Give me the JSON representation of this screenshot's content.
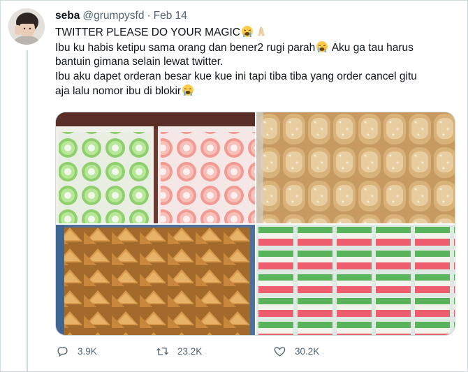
{
  "tweet": {
    "display_name": "seba",
    "handle": "@grumpysfd",
    "separator": "·",
    "date": "Feb 14",
    "line1": "TWITTER PLEASE DO YOUR MAGIC",
    "line2a": "Ibu ku habis ketipu sama orang dan bener2 rugi parah",
    "line2b": " Aku ga tau harus",
    "line3": "bantuin gimana selain lewat twitter.",
    "line4": "Ibu aku dapet orderan besar kue kue ini tapi tiba tiba yang order cancel gitu",
    "line5": "aja lalu nomor ibu di blokir",
    "emojis": [
      "loudly-crying-face-icon",
      "folded-hands-icon"
    ]
  },
  "media": [
    {
      "alt_icon": "green-pink-kue-mangkok-photo"
    },
    {
      "alt_icon": "sugar-donuts-photo"
    },
    {
      "alt_icon": "fried-pastel-photo"
    },
    {
      "alt_icon": "layered-kue-lapis-photo"
    }
  ],
  "actions": {
    "replies": "3.9K",
    "retweets": "23.2K",
    "likes": "30.2K"
  },
  "colors": {
    "text": "#0f1419",
    "secondary": "#536471",
    "border": "#cfd9de"
  }
}
